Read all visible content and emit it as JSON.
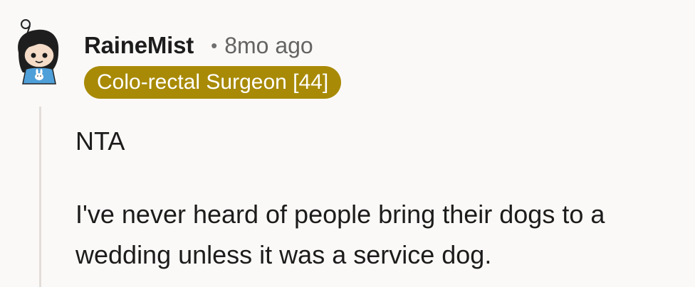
{
  "comment": {
    "author": "RaineMist",
    "separator": "•",
    "timestamp": "8mo ago",
    "flair": "Colo-rectal Surgeon [44]",
    "flair_color": "#a88a06",
    "avatar_icon": "snoo-avatar-icon",
    "body": {
      "paragraph_1": "NTA",
      "paragraph_2": "I've never heard of people bring their dogs to a wedding unless it was a service dog."
    }
  }
}
